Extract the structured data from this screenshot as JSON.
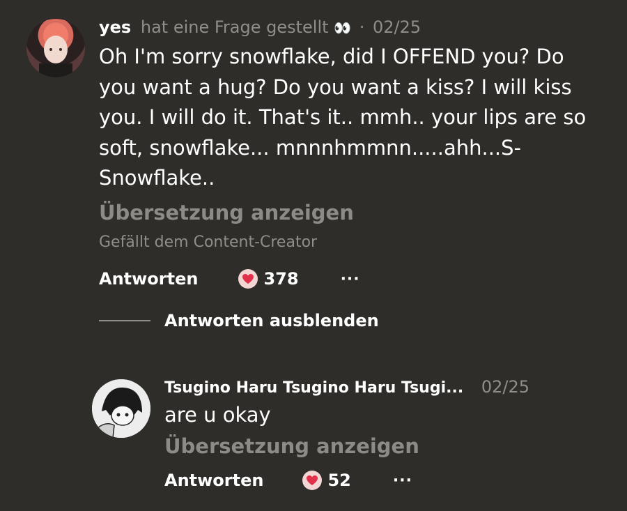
{
  "comment": {
    "username": "yes",
    "action": "hat eine Frage gestellt",
    "action_emoji": "👀",
    "separator": "·",
    "date": "02/25",
    "text": "Oh I'm sorry snowflake, did I OFFEND you? Do you want a hug? Do you want a kiss? I will kiss you. I will do it. That's it.. mmh.. your lips are so soft, snowflake... mnnnhmmnn.....ahh...S-Snowflake..",
    "translate_label": "Übersetzung anzeigen",
    "liked_by_creator": "Gefällt dem Content-Creator",
    "reply_label": "Antworten",
    "like_count": "378",
    "more": "···"
  },
  "hide_replies_label": "Antworten ausblenden",
  "reply": {
    "username": "Tsugino Haru Tsugino Haru Tsugi...",
    "date": "02/25",
    "text": "are u okay",
    "translate_label": "Übersetzung anzeigen",
    "reply_label": "Antworten",
    "like_count": "52",
    "more": "···"
  },
  "colors": {
    "background": "#2e2d29",
    "muted": "#8f8e89",
    "heart": "#e0304a",
    "heart_bg": "#f3d5d4"
  },
  "icons": {
    "heart": "heart-icon",
    "more": "more-icon"
  }
}
